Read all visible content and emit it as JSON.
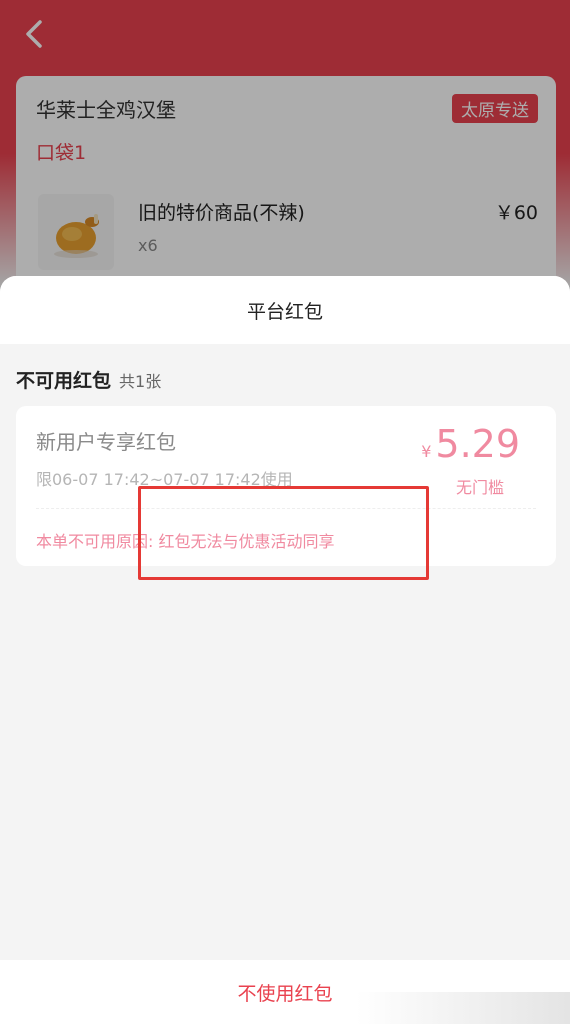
{
  "background": {
    "shop_name": "华莱士全鸡汉堡",
    "shop_badge": "太原专送",
    "bag_label": "口袋1",
    "goods": {
      "name": "旧的特价商品(不辣)",
      "qty": "x6",
      "price": "￥60"
    }
  },
  "sheet": {
    "title": "平台红包",
    "section_title": "不可用红包",
    "section_count": "共1张",
    "coupon": {
      "name": "新用户专享红包",
      "period": "限06-07 17:42~07-07 17:42使用",
      "currency": "¥",
      "amount": "5.29",
      "threshold": "无门槛",
      "reason": "本单不可用原因: 红包无法与优惠活动同享"
    },
    "footer_label": "不使用红包"
  },
  "icons": {
    "back": "chevron-left-icon",
    "food": "roast-chicken-icon"
  },
  "colors": {
    "brand_red": "#e9424f",
    "coupon_pink": "#f08aa0",
    "highlight_red": "#e53935"
  }
}
